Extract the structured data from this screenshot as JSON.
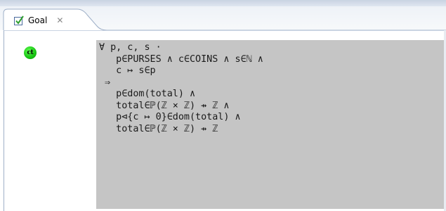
{
  "tab": {
    "label": "Goal",
    "close_symbol": "✕",
    "icon": "goal-checkbox-icon"
  },
  "status_badge": {
    "text": "ct",
    "color": "#17c412"
  },
  "colors": {
    "panel_background": "#c5c5c5",
    "tab_border": "#9fb0c8"
  },
  "goal": {
    "lines": [
      "∀ p, c, s ·",
      "   p∈PURSES ∧ c∈COINS ∧ s∈ℕ ∧",
      "   c ↦ s∈p",
      " ⇒",
      "   p∈dom(total) ∧",
      "   total∈ℙ(ℤ × ℤ) ⇸ ℤ ∧",
      "   p⊲{c ↦ 0}∈dom(total) ∧",
      "   total∈ℙ(ℤ × ℤ) ⇸ ℤ"
    ]
  }
}
